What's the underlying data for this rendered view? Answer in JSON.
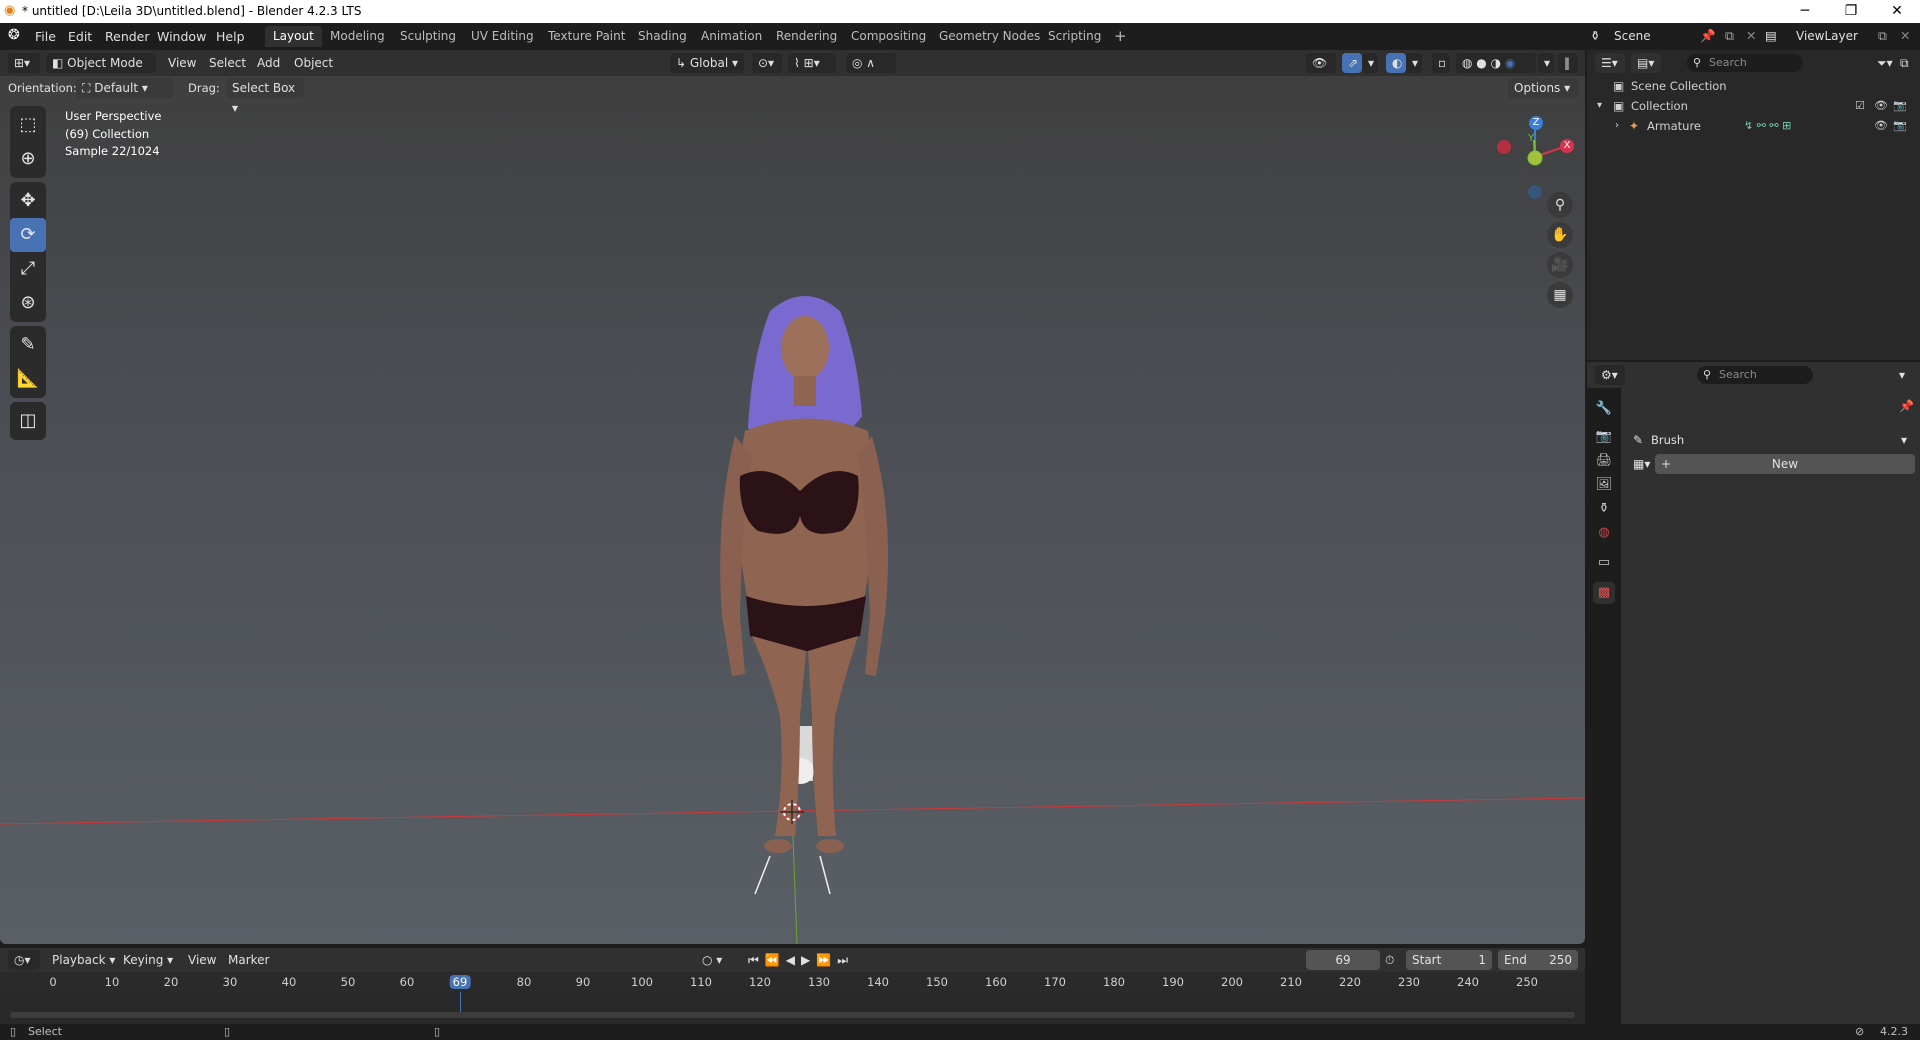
{
  "window": {
    "title": "* untitled [D:\\Leila 3D\\untitled.blend] - Blender 4.2.3 LTS",
    "minimize": "─",
    "maximize": "❐",
    "close": "✕"
  },
  "menus": [
    "File",
    "Edit",
    "Render",
    "Window",
    "Help"
  ],
  "workspaces": [
    "Layout",
    "Modeling",
    "Sculpting",
    "UV Editing",
    "Texture Paint",
    "Shading",
    "Animation",
    "Rendering",
    "Compositing",
    "Geometry Nodes",
    "Scripting",
    "+"
  ],
  "active_workspace": "Layout",
  "scene": {
    "label": "Scene",
    "view_layer": "ViewLayer"
  },
  "viewport_header": {
    "mode": "Object Mode",
    "menus": [
      "View",
      "Select",
      "Add",
      "Object"
    ],
    "transform": "Global",
    "orientation_label": "Orientation:",
    "orientation_value": "Default",
    "drag_label": "Drag:",
    "drag_value": "Select Box",
    "options": "Options"
  },
  "hud": {
    "line1": "User Perspective",
    "line2": "(69) Collection",
    "line3": "Sample 22/1024"
  },
  "gizmo": {
    "z": "Z",
    "y": "Y",
    "x": "X"
  },
  "timeline": {
    "menus": [
      "Playback",
      "Keying",
      "View",
      "Marker"
    ],
    "current_frame": "69",
    "start_label": "Start",
    "start_value": "1",
    "end_label": "End",
    "end_value": "250",
    "ticks": [
      "0",
      "10",
      "20",
      "30",
      "40",
      "50",
      "60",
      "69",
      "80",
      "90",
      "100",
      "110",
      "120",
      "130",
      "140",
      "150",
      "160",
      "170",
      "180",
      "190",
      "200",
      "210",
      "220",
      "230",
      "240",
      "250"
    ]
  },
  "status": {
    "left": "Select",
    "version": "4.2.3"
  },
  "outliner": {
    "search_placeholder": "Search",
    "scene_collection": "Scene Collection",
    "collection": "Collection",
    "armature": "Armature"
  },
  "properties": {
    "search_placeholder": "Search",
    "brush_label": "Brush",
    "new_button": "New"
  },
  "colors": {
    "accent": "#4772b3",
    "x_axis": "#d6344d",
    "y_axis": "#77c23a",
    "z_axis": "#3b7fd8"
  }
}
